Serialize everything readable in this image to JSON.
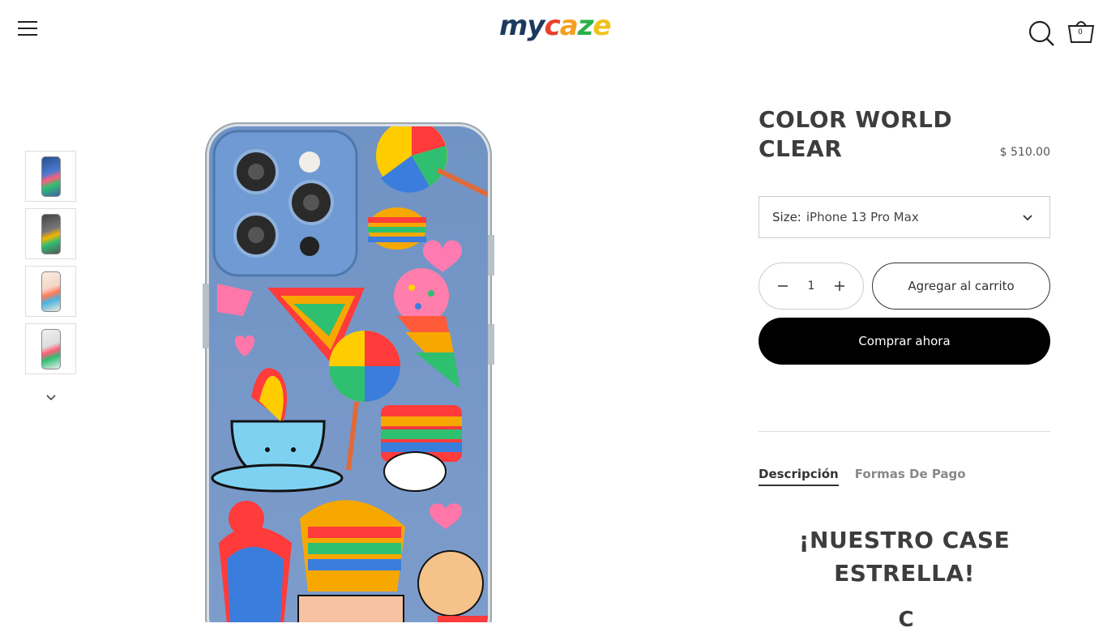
{
  "header": {
    "logo_text_my": "my",
    "logo_letters": [
      "c",
      "a",
      "z",
      "e"
    ],
    "cart_count": "0"
  },
  "product": {
    "title": "COLOR WORLD CLEAR",
    "price": "$ 510.00",
    "size_label": "Size:",
    "size_value": "iPhone 13 Pro Max",
    "quantity": "1",
    "add_to_cart_label": "Agregar al carrito",
    "buy_now_label": "Comprar ahora"
  },
  "tabs": [
    {
      "label": "Descripción"
    },
    {
      "label": "Formas De Pago"
    }
  ],
  "description": {
    "heading": "¡NUESTRO CASE ESTRELLA!",
    "partial_line": "C"
  },
  "colors": {
    "primary_button": "#000000",
    "logo_dark": "#1c3a5c"
  },
  "icons": [
    "menu-icon",
    "search-icon",
    "cart-icon",
    "minus-icon",
    "plus-icon",
    "chevron-down-icon"
  ]
}
